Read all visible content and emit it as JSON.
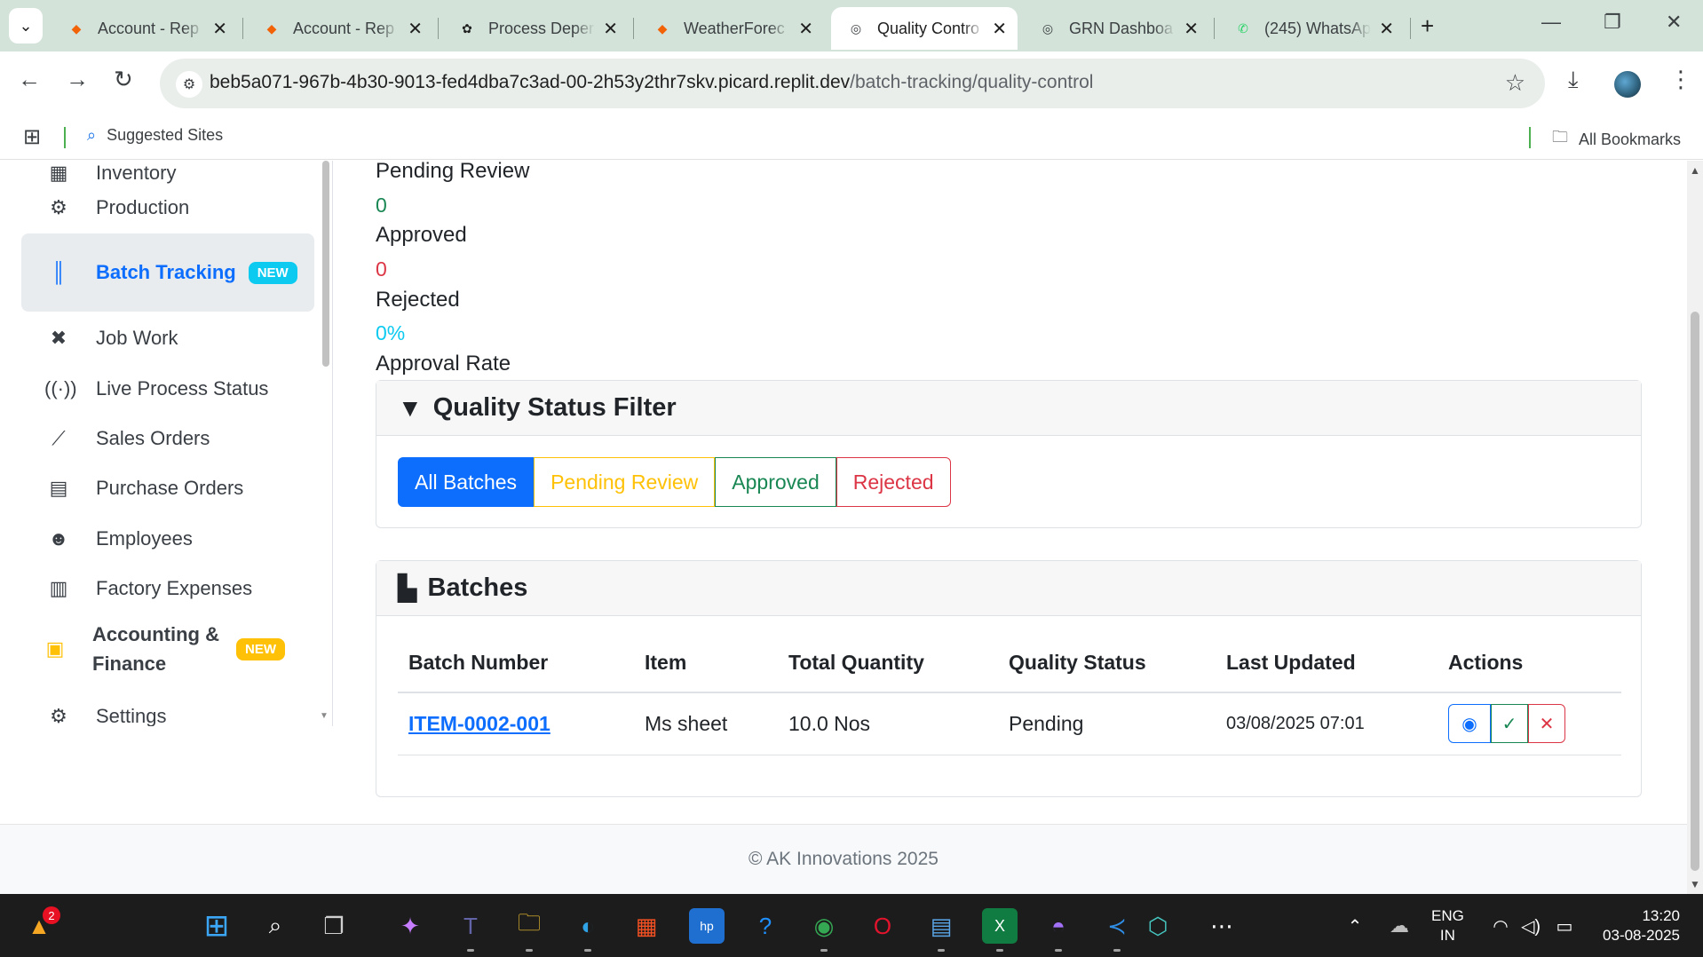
{
  "browser": {
    "tabs": [
      {
        "label": "Account - Rep",
        "icon": "replit-icon"
      },
      {
        "label": "Account - Rep",
        "icon": "replit-icon"
      },
      {
        "label": "Process Deper",
        "icon": "chatgpt-icon"
      },
      {
        "label": "WeatherForec",
        "icon": "replit-icon"
      },
      {
        "label": "Quality Contro",
        "icon": "globe-icon"
      },
      {
        "label": "GRN Dashboa",
        "icon": "globe-icon"
      },
      {
        "label": "(245) WhatsAp",
        "icon": "whatsapp-icon"
      }
    ],
    "url_host": "beb5a071-967b-4b30-9013-fed4dba7c3ad-00-2h53y2thr7skv.picard.replit.dev",
    "url_path": "/batch-tracking/quality-control",
    "bookmarks": {
      "suggested": "Suggested Sites",
      "all": "All Bookmarks"
    }
  },
  "sidebar": {
    "items": [
      {
        "label": "Inventory",
        "icon": "inventory-icon"
      },
      {
        "label": "Production",
        "icon": "cogs-icon"
      },
      {
        "label": "Batch Tracking",
        "icon": "barcode-icon",
        "badge": "NEW"
      },
      {
        "label": "Job Work",
        "icon": "tools-icon"
      },
      {
        "label": "Live Process Status",
        "icon": "broadcast-icon"
      },
      {
        "label": "Sales Orders",
        "icon": "chart-line-icon"
      },
      {
        "label": "Purchase Orders",
        "icon": "file-invoice-icon"
      },
      {
        "label": "Employees",
        "icon": "users-icon"
      },
      {
        "label": "Factory Expenses",
        "icon": "receipt-icon"
      },
      {
        "label": "Accounting &",
        "label2": "Finance",
        "icon": "calculator-icon",
        "badge": "NEW"
      },
      {
        "label": "Settings",
        "icon": "gear-icon"
      }
    ]
  },
  "stats": [
    {
      "label": "Pending Review",
      "value": "0",
      "color": "#198754"
    },
    {
      "label": "Approved",
      "value": "0",
      "color": "#dc3545"
    },
    {
      "label": "Rejected",
      "value": "0%",
      "color": "#0dcaf0"
    },
    {
      "label": "Approval Rate"
    }
  ],
  "filter": {
    "title": "Quality Status Filter",
    "buttons": [
      "All Batches",
      "Pending Review",
      "Approved",
      "Rejected"
    ],
    "active": "All Batches"
  },
  "batches": {
    "title": "Batches",
    "columns": [
      "Batch Number",
      "Item",
      "Total Quantity",
      "Quality Status",
      "Last Updated",
      "Actions"
    ],
    "rows": [
      {
        "batch_number": "ITEM-0002-001",
        "item": "Ms sheet",
        "total_quantity": "10.0 Nos",
        "quality_status": "Pending",
        "last_updated": "03/08/2025 07:01"
      }
    ]
  },
  "footer": "© AK Innovations 2025",
  "taskbar": {
    "notification_count": "2",
    "lang_top": "ENG",
    "lang_bottom": "IN",
    "time": "13:20",
    "date": "03-08-2025"
  },
  "colors": {
    "primary": "#0d6efd",
    "success": "#198754",
    "danger": "#dc3545",
    "warning": "#ffc107",
    "info": "#0dcaf0",
    "chrome_tabbar": "#d3e3d9"
  }
}
